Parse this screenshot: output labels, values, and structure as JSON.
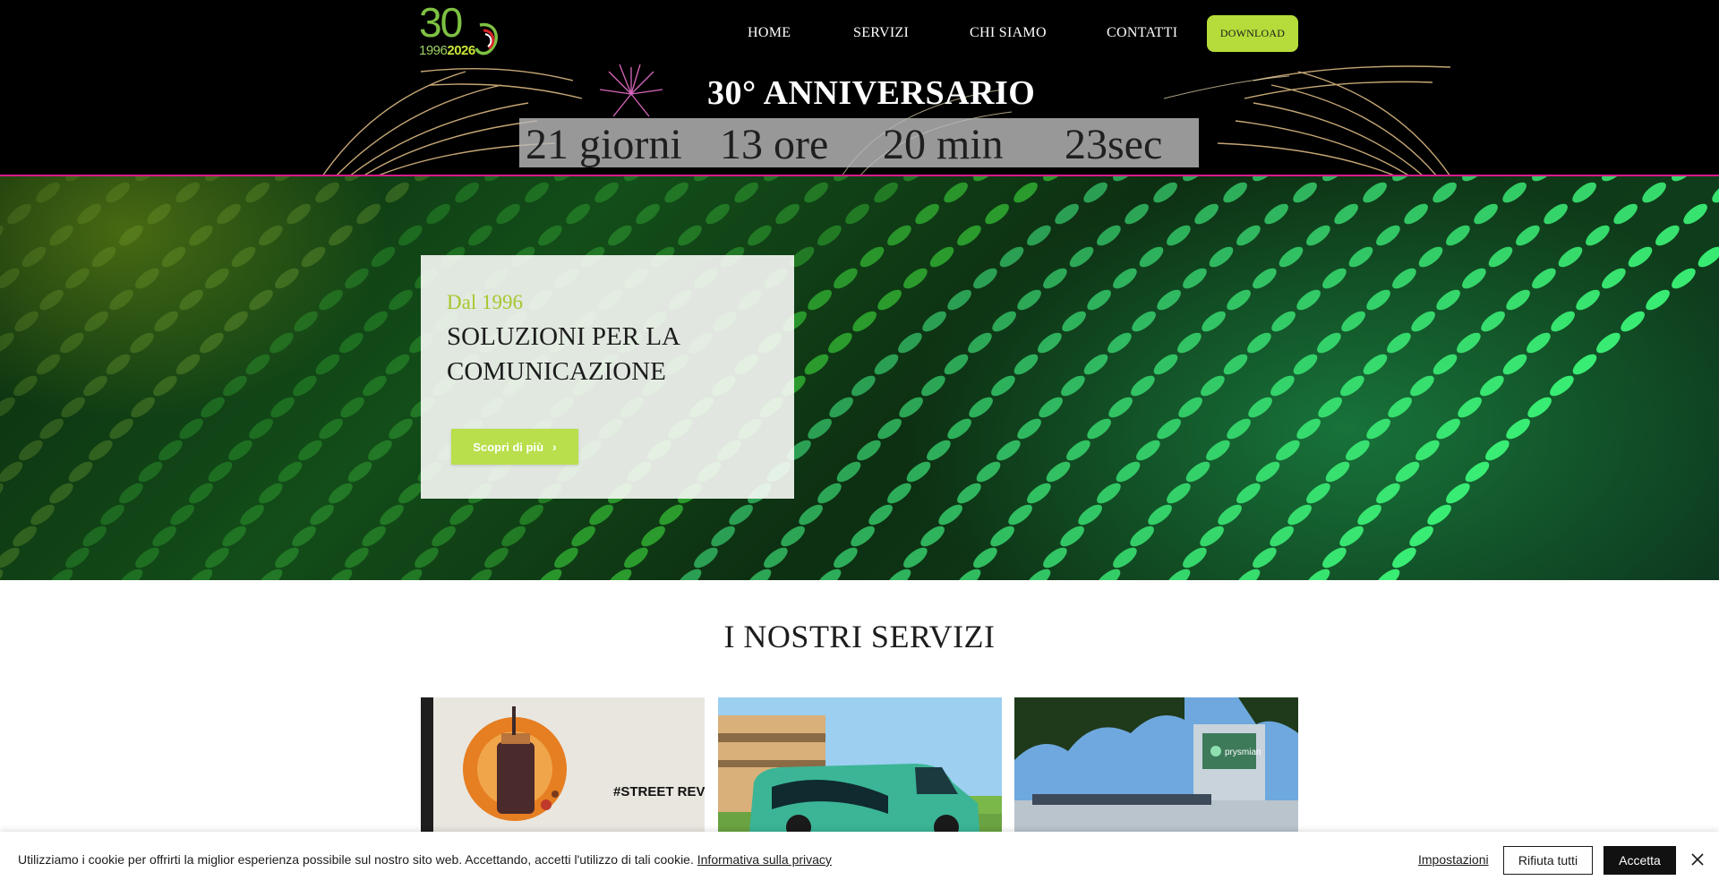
{
  "logo": {
    "number": "30",
    "year_start": "1996",
    "year_end": "2026"
  },
  "nav": {
    "items": [
      {
        "label": "HOME"
      },
      {
        "label": "SERVIZI"
      },
      {
        "label": "CHI SIAMO"
      },
      {
        "label": "CONTATTI"
      }
    ],
    "download_label": "DOWNLOAD"
  },
  "anniversary": {
    "title": "30° ANNIVERSARIO",
    "countdown": {
      "days": "21 giorni",
      "hours": "13 ore",
      "minutes": "20 min",
      "seconds": "23sec"
    }
  },
  "hero": {
    "since": "Dal 1996",
    "title": "SOLUZIONI PER LA COMUNICAZIONE",
    "button_label": "Scopri di più"
  },
  "services": {
    "title": "I NOSTRI SERVIZI",
    "cards": [
      {
        "caption": "#STREET REVOLUTION"
      },
      {
        "caption": ""
      },
      {
        "caption": "prysmian"
      }
    ]
  },
  "cookie": {
    "text": "Utilizziamo i cookie per offrirti la miglior esperienza possibile sul nostro sito web. Accettando, accetti l'utilizzo di tali cookie.",
    "privacy_link": "Informativa sulla privacy",
    "settings_label": "Impostazioni",
    "reject_label": "Rifiuta tutti",
    "accept_label": "Accetta"
  },
  "colors": {
    "accent_green": "#b5dc3a",
    "header_border": "#d81b8c",
    "since_green": "#a6c72e"
  },
  "icons": {
    "close": "close-icon",
    "chevron": "chevron-right-icon"
  }
}
